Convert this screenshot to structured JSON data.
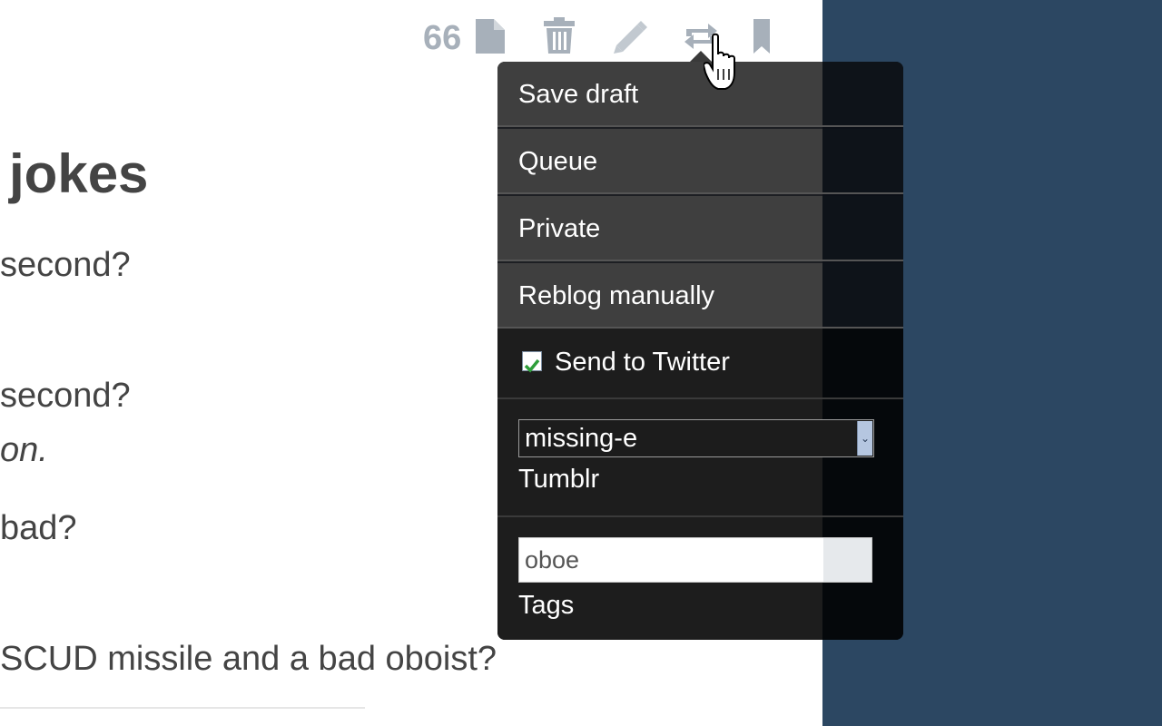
{
  "post": {
    "title": " jokes",
    "lines": [
      " second?",
      " second?",
      "on.",
      "bad?",
      " SCUD missile and a bad oboist?"
    ]
  },
  "controls": {
    "note_count": "66",
    "icons": [
      "notes-file-icon",
      "delete-trash-icon",
      "edit-pencil-icon",
      "reblog-icon",
      "bookmark-icon"
    ]
  },
  "menu": {
    "save_draft": "Save draft",
    "queue": "Queue",
    "private": "Private",
    "reblog_manually": "Reblog manually",
    "send_to_twitter": "Send to Twitter",
    "send_to_twitter_checked": true,
    "blog_select": {
      "value": "missing-e",
      "label": "Tumblr"
    },
    "tags": {
      "value": "oboe",
      "label": "Tags"
    }
  },
  "colors": {
    "blue_panel": "#2c4762",
    "menu_item_bg": "#3f3f3f",
    "popup_bg": "#1d1d1d",
    "icon_gray": "#a7b0ba",
    "check_green": "#2e9e3a"
  }
}
